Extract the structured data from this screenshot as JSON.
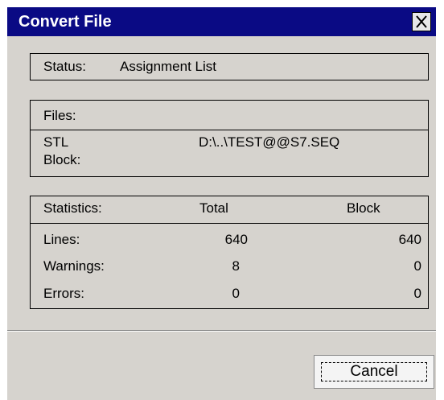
{
  "window": {
    "title": "Convert File"
  },
  "status": {
    "label": "Status:",
    "value": "Assignment List"
  },
  "files": {
    "header": "Files:",
    "stl_label": "STL",
    "stl_value": "D:\\..\\TEST@@S7.SEQ",
    "block_label": "Block:"
  },
  "statistics": {
    "header": "Statistics:",
    "columns": [
      "Total",
      "Block"
    ],
    "rows": [
      {
        "label": "Lines:",
        "total": "640",
        "block": "640"
      },
      {
        "label": "Warnings:",
        "total": "8",
        "block": "0"
      },
      {
        "label": "Errors:",
        "total": "0",
        "block": "0"
      }
    ]
  },
  "buttons": {
    "cancel": "Cancel"
  },
  "colors": {
    "titlebar": "#0a0a84",
    "dialog_bg": "#d6d3ce"
  },
  "icons": {
    "close": "close-icon"
  }
}
